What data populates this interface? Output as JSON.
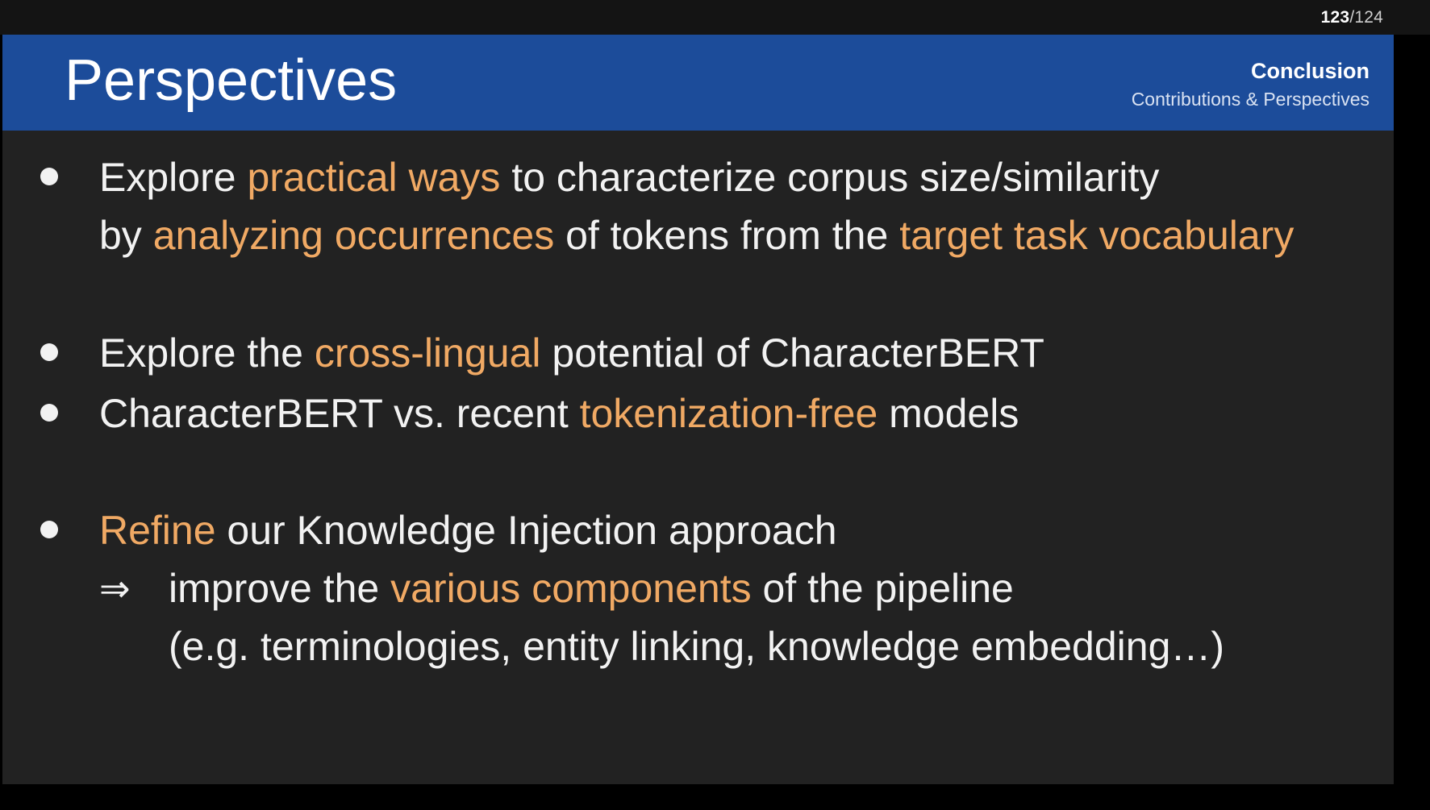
{
  "page_counter": {
    "current": "123",
    "total": "/124"
  },
  "header": {
    "title": "Perspectives",
    "section": "Conclusion",
    "subsection": "Contributions & Perspectives"
  },
  "bullets": [
    {
      "line1": {
        "t1": "Explore ",
        "h1": "practical ways",
        "t2": " to characterize corpus size/similarity"
      },
      "line2": {
        "t1": "by ",
        "h1": "analyzing occurrences",
        "t2": " of tokens from the ",
        "h2": "target task vocabulary"
      }
    },
    {
      "line1": {
        "t1": "Explore the ",
        "h1": "cross-lingual",
        "t2": " potential of CharacterBERT"
      }
    },
    {
      "line1": {
        "t1": "CharacterBERT vs. recent ",
        "h1": "tokenization-free",
        "t2": " models"
      }
    },
    {
      "line1": {
        "h1": "Refine",
        "t1": " our Knowledge Injection approach"
      },
      "arrow": "⇒",
      "line2": {
        "t1": "improve the ",
        "h1": "various components",
        "t2": " of the pipeline"
      },
      "line3": {
        "t1": "(e.g. terminologies, entity linking, knowledge embedding…)"
      }
    }
  ],
  "colors": {
    "header_bg": "#1c4c9a",
    "slide_bg": "#222222",
    "highlight": "#f0a964",
    "text": "#f2f2f2"
  }
}
